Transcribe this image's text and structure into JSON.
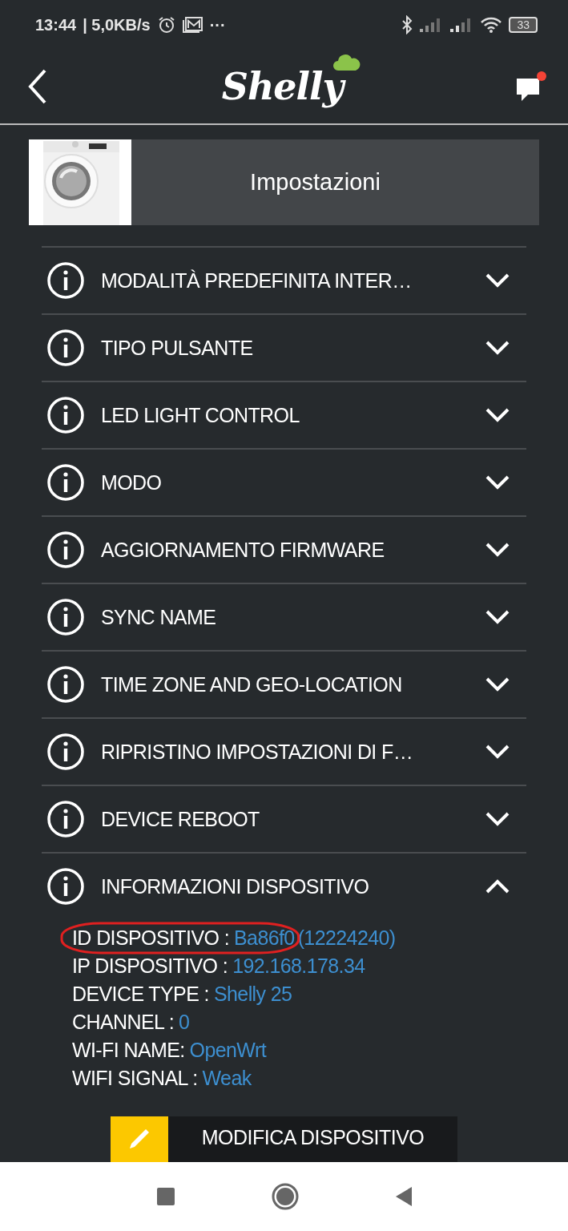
{
  "status_bar": {
    "time": "13:44",
    "speed": "| 5,0KB/s",
    "more": "···",
    "battery": "33"
  },
  "header": {
    "logo": "Shelly",
    "notification_unread": true
  },
  "device_card": {
    "title": "Impostazioni"
  },
  "settings": [
    {
      "label": "MODALITÀ PREDEFINITA INTER…",
      "expanded": false
    },
    {
      "label": "TIPO PULSANTE",
      "expanded": false
    },
    {
      "label": "LED LIGHT CONTROL",
      "expanded": false
    },
    {
      "label": "MODO",
      "expanded": false
    },
    {
      "label": "AGGIORNAMENTO FIRMWARE",
      "expanded": false
    },
    {
      "label": "SYNC NAME",
      "expanded": false
    },
    {
      "label": "TIME ZONE AND GEO-LOCATION",
      "expanded": false
    },
    {
      "label": "RIPRISTINO IMPOSTAZIONI DI F…",
      "expanded": false
    },
    {
      "label": "DEVICE REBOOT",
      "expanded": false
    },
    {
      "label": "INFORMAZIONI DISPOSITIVO",
      "expanded": true
    }
  ],
  "device_info": [
    {
      "label": "ID DISPOSITIVO :",
      "value": "Ba86f0",
      "extra": "(12224240)",
      "highlighted": true
    },
    {
      "label": "IP DISPOSITIVO :",
      "value": "192.168.178.34"
    },
    {
      "label": "DEVICE TYPE :",
      "value": "Shelly 25"
    },
    {
      "label": "CHANNEL :",
      "value": "0"
    },
    {
      "label": "WI-FI NAME:",
      "value": "OpenWrt"
    },
    {
      "label": "WIFI SIGNAL :",
      "value": "Weak"
    }
  ],
  "edit_button": {
    "label": "MODIFICA DISPOSITIVO"
  }
}
